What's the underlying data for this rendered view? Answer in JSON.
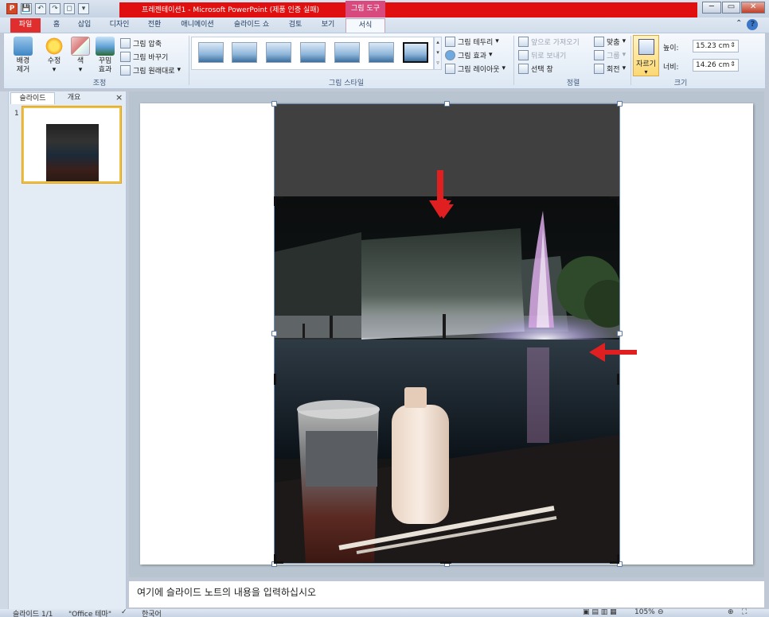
{
  "window": {
    "title": "프레젠테이션1 - Microsoft PowerPoint (제품 인증 실패)",
    "contextual_tab_group": "그림 도구",
    "controls": [
      "─",
      "▭",
      "✕"
    ]
  },
  "quick_access": [
    "P",
    "💾",
    "↶",
    "↷",
    "◻",
    "▾"
  ],
  "ribbon": {
    "tabs": [
      "파일",
      "홈",
      "삽입",
      "디자인",
      "전환",
      "애니메이션",
      "슬라이드 쇼",
      "검토",
      "보기",
      "서식"
    ],
    "active_tab": "서식",
    "adjust": {
      "buttons": [
        {
          "label": "배경\n제거",
          "icon": "remove-background-icon"
        },
        {
          "label": "수정",
          "icon": "corrections-icon"
        },
        {
          "label": "색",
          "icon": "color-icon"
        },
        {
          "label": "꾸밈\n효과",
          "icon": "artistic-effects-icon"
        }
      ],
      "small": [
        "그림 압축",
        "그림 바꾸기",
        "그림 원래대로"
      ],
      "group_label": "조정"
    },
    "picture_styles": {
      "group_label": "그림 스타일",
      "options": [
        "그림 테두리",
        "그림 효과",
        "그림 레이아웃"
      ]
    },
    "arrange": {
      "group_label": "정렬",
      "items": [
        "앞으로 가져오기",
        "뒤로 보내기",
        "선택 창",
        "맞춤",
        "그룹",
        "회전"
      ]
    },
    "size": {
      "group_label": "크기",
      "crop_label": "자르기",
      "height_label": "높이:",
      "height_value": "15.23 cm",
      "width_label": "너비:",
      "width_value": "14.26 cm"
    }
  },
  "slides_pane": {
    "tabs": [
      "슬라이드",
      "개요"
    ],
    "close": "×",
    "slides": [
      {
        "number": "1"
      }
    ]
  },
  "notes": {
    "placeholder": "여기에 슬라이드 노트의 내용을 입력하십시오"
  },
  "statusbar": {
    "slide_info": "슬라이드 1/1",
    "theme": "\"Office 테마\"",
    "language": "한국어",
    "zoom": "105%"
  },
  "colors": {
    "accent_red": "#e01010",
    "contextual_pink": "#d84a7e",
    "annotation_arrow": "#e02020"
  }
}
